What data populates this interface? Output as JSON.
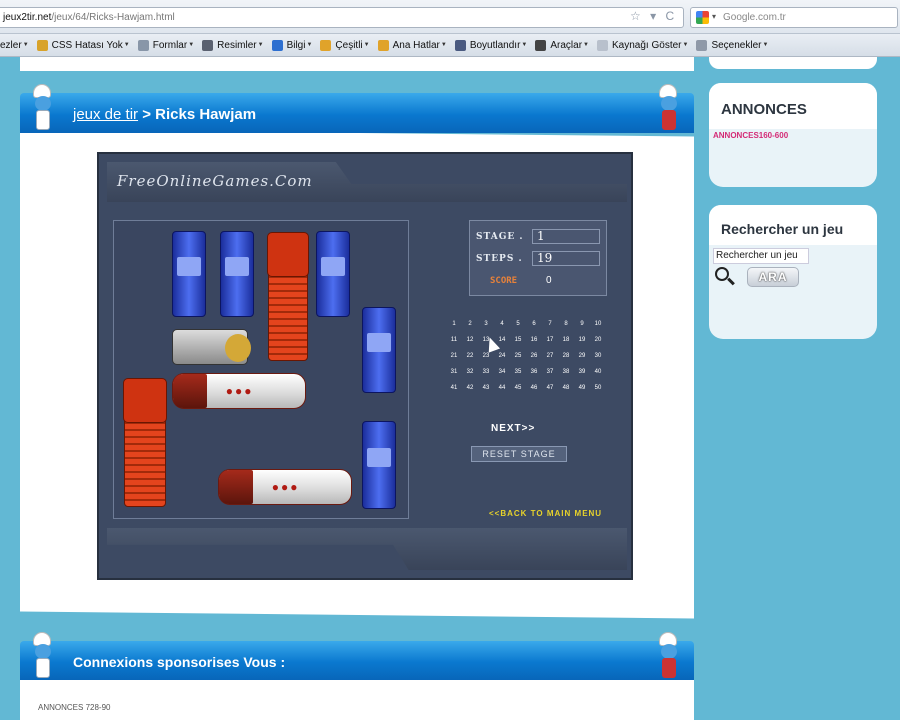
{
  "browser": {
    "url_host": "jeux2tir.net",
    "url_path": "/jeux/64/Ricks-Hawjam.html",
    "url_icons": "☆ ▾ C",
    "search_engine": "Google.com.tr",
    "bookmarks": [
      {
        "label": "ezler",
        "icon_color": "#c94",
        "caret": true
      },
      {
        "label": "CSS Hatası Yok",
        "icon_color": "#d8a32a",
        "caret": true
      },
      {
        "label": "Formlar",
        "icon_color": "#8896a8",
        "caret": true
      },
      {
        "label": "Resimler",
        "icon_color": "#5a6170",
        "caret": true
      },
      {
        "label": "Bilgi",
        "icon_color": "#2d6fd0",
        "caret": true
      },
      {
        "label": "Çeşitli",
        "icon_color": "#e0a32a",
        "caret": true
      },
      {
        "label": "Ana Hatlar",
        "icon_color": "#e0a32a",
        "caret": true
      },
      {
        "label": "Boyutlandır",
        "icon_color": "#4a5a80",
        "caret": true
      },
      {
        "label": "Araçlar",
        "icon_color": "#444",
        "caret": true
      },
      {
        "label": "Kaynağı Göster",
        "icon_color": "#b8c0cc",
        "caret": true
      },
      {
        "label": "Seçenekler",
        "icon_color": "#8f99a8",
        "caret": true
      }
    ]
  },
  "page": {
    "breadcrumb_link": "jeux de tir",
    "breadcrumb_sep": " > ",
    "breadcrumb_current": "Ricks Hawjam",
    "sponsored_title": "Connexions sponsorises Vous :",
    "bottom_ad": "ANNONCES 728-90"
  },
  "game": {
    "logo": "FreeOnlineGames.Com",
    "stage_label": "STAGE .",
    "stage_value": "1",
    "steps_label": "STEPS .",
    "steps_value": "19",
    "score_label": "SCORE",
    "score_value": "0",
    "levels": [
      "1",
      "2",
      "3",
      "4",
      "5",
      "6",
      "7",
      "8",
      "9",
      "10",
      "11",
      "12",
      "13",
      "14",
      "15",
      "16",
      "17",
      "18",
      "19",
      "20",
      "21",
      "22",
      "23",
      "24",
      "25",
      "26",
      "27",
      "28",
      "29",
      "30",
      "31",
      "32",
      "33",
      "34",
      "35",
      "36",
      "37",
      "38",
      "39",
      "40",
      "41",
      "42",
      "43",
      "44",
      "45",
      "46",
      "47",
      "48",
      "49",
      "50"
    ],
    "next_label": "NEXT>>",
    "reset_label": "RESET STAGE",
    "back_label": "<<BACK TO MAIN MENU"
  },
  "sidebar": {
    "annonces_title": "ANNONCES",
    "annonces_sub": "ANNONCES160-600",
    "search_title": "Rechercher un jeu",
    "search_value": "Rechercher un jeu",
    "search_button": "ARA"
  },
  "colors": {
    "page_bg": "#62b8d4",
    "title_bar": "#0a78cf",
    "game_bg": "#3d4a63",
    "back_link": "#e7d22b",
    "score_label": "#e8823a",
    "annonces_sub": "#d42a76"
  }
}
